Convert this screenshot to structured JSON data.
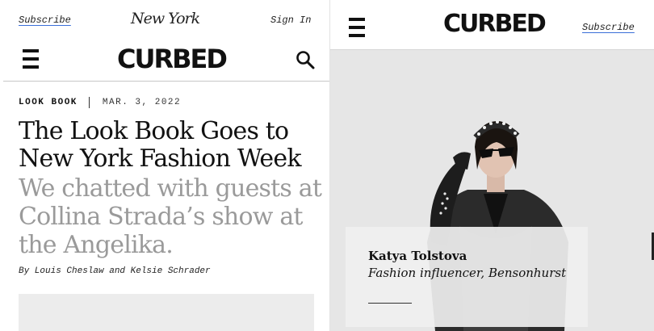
{
  "left": {
    "topbar": {
      "subscribe": "Subscribe",
      "brand": "New York",
      "sign_in": "Sign In"
    },
    "nav": {
      "logo": "CURBED",
      "menu_icon": "hamburger-icon",
      "search_icon": "search-icon"
    },
    "article": {
      "rubric": "LOOK BOOK",
      "date": "MAR. 3, 2022",
      "headline": "The Look Book Goes to New York Fashion Week",
      "dek": "We chatted with guests at Collina Strada’s show at the Angelika.",
      "byline": "By Louis Cheslaw and Kelsie Schrader"
    }
  },
  "right": {
    "header": {
      "logo": "CURBED",
      "subscribe": "Subscribe",
      "menu_icon": "hamburger-icon"
    },
    "caption": {
      "name": "Katya Tolstova",
      "description": "Fashion influencer, Bensonhurst"
    }
  },
  "colors": {
    "link_underline": "#3a6fd8",
    "dek_gray": "#9a9a9a",
    "panel_gray": "#e6e6e6"
  }
}
